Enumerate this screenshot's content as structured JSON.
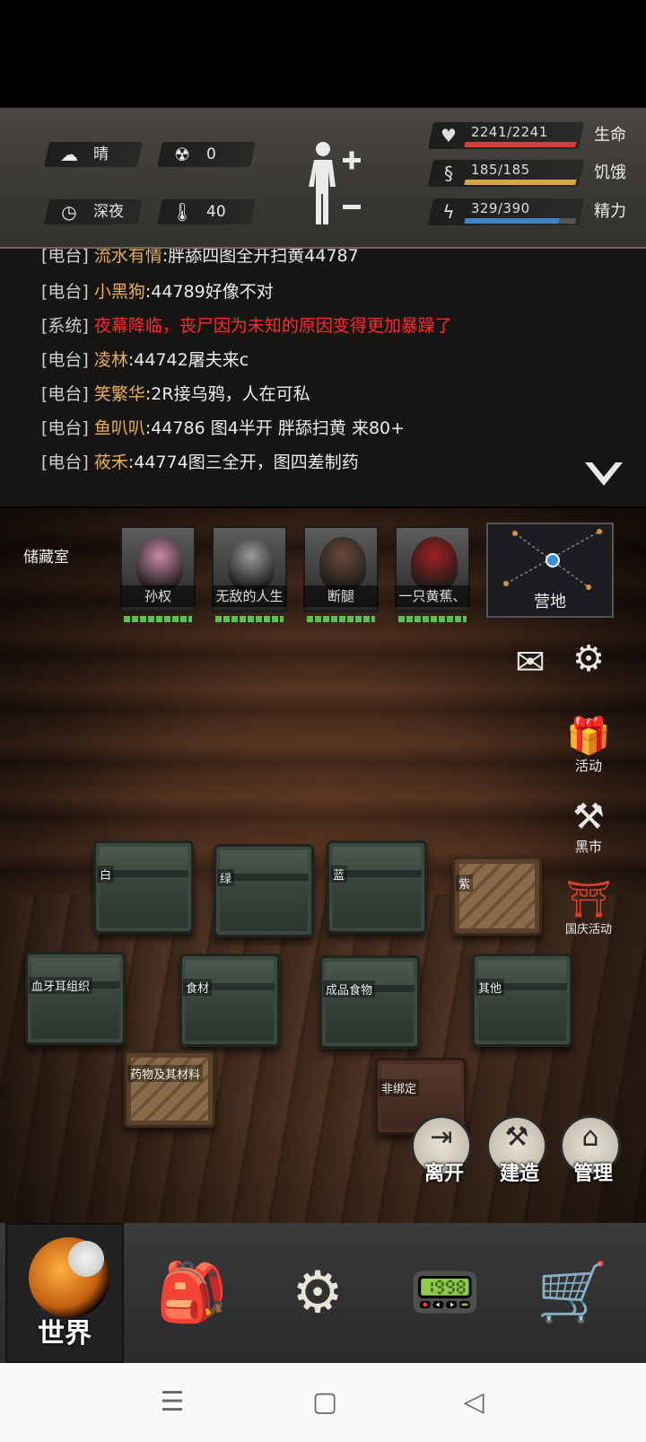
{
  "status": {
    "weather": {
      "icon": "cloud-sun-icon",
      "label": "晴"
    },
    "radiation": {
      "icon": "radiation-icon",
      "value": "0"
    },
    "time": {
      "icon": "clock-icon",
      "label": "深夜"
    },
    "temperature": {
      "icon": "thermometer-icon",
      "value": "40"
    },
    "body_icon": "human-body-icon",
    "stats": [
      {
        "name": "life",
        "label": "生命",
        "value": "2241/2241",
        "fraction": 1.0,
        "color": "#d0403a",
        "icon": "heart-icon"
      },
      {
        "name": "hunger",
        "label": "饥饿",
        "value": "185/185",
        "fraction": 1.0,
        "color": "#d8a548",
        "icon": "stomach-icon"
      },
      {
        "name": "energy",
        "label": "精力",
        "value": "329/390",
        "fraction": 0.8436,
        "color": "#3d85c6",
        "icon": "energy-head-icon"
      }
    ]
  },
  "chat": {
    "messages": [
      {
        "channel": "[电台]",
        "name": "流水有情",
        "text": ":胖舔四图全开扫黄44787",
        "system": false
      },
      {
        "channel": "[电台]",
        "name": "小黑狗",
        "text": ":44789好像不对",
        "system": false
      },
      {
        "channel": "[系统]",
        "name": "夜幕降临，",
        "text": "丧尸因为未知的原因变得更加暴躁了",
        "system": true
      },
      {
        "channel": "[电台]",
        "name": "凌林",
        "text": ":44742屠夫来c",
        "system": false
      },
      {
        "channel": "[电台]",
        "name": "笑繁华",
        "text": ":2R接乌鸦，人在可私",
        "system": false
      },
      {
        "channel": "[电台]",
        "name": "鱼叭叭",
        "text": ":44786 图4半开 胖舔扫黄 来80+",
        "system": false
      },
      {
        "channel": "[电台]",
        "name": "莜禾",
        "text": ":44774图三全开，图四差制药",
        "system": false
      }
    ],
    "collapse_icon": "chevron-down-icon"
  },
  "room": {
    "title": "储藏室",
    "survivors": [
      {
        "name": "孙权",
        "hair": "#c98aa6"
      },
      {
        "name": "无敌的人生",
        "hair": "#9a9a9a"
      },
      {
        "name": "断腿",
        "hair": "#6a4a3a"
      },
      {
        "name": "一只黄蕉、",
        "hair": "#a02020"
      }
    ],
    "camp_label": "营地",
    "side_buttons": [
      {
        "name": "mail",
        "icon": "envelope-icon",
        "label": ""
      },
      {
        "name": "settings",
        "icon": "gear-icon",
        "label": ""
      },
      {
        "name": "activities",
        "icon": "gift-icon",
        "label": "活动"
      },
      {
        "name": "black-market",
        "icon": "gavel-icon",
        "label": "黑市"
      },
      {
        "name": "national-day",
        "icon": "temple-icon",
        "label": "国庆活动"
      }
    ],
    "crates": [
      {
        "label": "白",
        "style": "metal"
      },
      {
        "label": "绿",
        "style": "metal"
      },
      {
        "label": "蓝",
        "style": "metal"
      },
      {
        "label": "紫",
        "style": "wood"
      },
      {
        "label": "血牙耳组织",
        "style": "metal"
      },
      {
        "label": "食材",
        "style": "metal"
      },
      {
        "label": "成品食物",
        "style": "metal"
      },
      {
        "label": "其他",
        "style": "metal"
      },
      {
        "label": "药物及其材料",
        "style": "wood"
      },
      {
        "label": "非绑定",
        "style": "dark"
      }
    ],
    "actions": [
      {
        "label": "离开",
        "icon": "leave-icon"
      },
      {
        "label": "建造",
        "icon": "build-icon"
      },
      {
        "label": "管理",
        "icon": "manage-icon"
      }
    ]
  },
  "dock": {
    "world_label": "世界",
    "items": [
      {
        "name": "backpack",
        "icon": "backpack-icon"
      },
      {
        "name": "skills",
        "icon": "brain-gears-icon"
      },
      {
        "name": "radio",
        "icon": "walkie-talkie-icon"
      },
      {
        "name": "shop",
        "icon": "cart-icon"
      }
    ]
  },
  "navbar": {
    "items": [
      {
        "name": "menu",
        "icon": "menu-icon"
      },
      {
        "name": "home",
        "icon": "square-icon"
      },
      {
        "name": "back",
        "icon": "back-triangle-icon"
      }
    ]
  }
}
